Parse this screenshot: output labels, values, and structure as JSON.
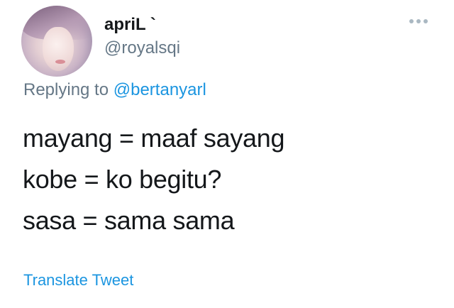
{
  "author": {
    "display_name": "apriL `",
    "handle": "@royalsqi"
  },
  "reply": {
    "prefix": "Replying to",
    "mention": "@bertanyarl"
  },
  "tweet": {
    "lines": [
      "mayang = maaf sayang",
      "kobe = ko begitu?",
      "sasa = sama sama"
    ]
  },
  "actions": {
    "translate_label": "Translate Tweet",
    "more_icon": "more-dots-icon"
  },
  "colors": {
    "text": "#14171a",
    "secondary": "#657786",
    "link": "#1b95e0",
    "icon": "#aab8c2"
  }
}
